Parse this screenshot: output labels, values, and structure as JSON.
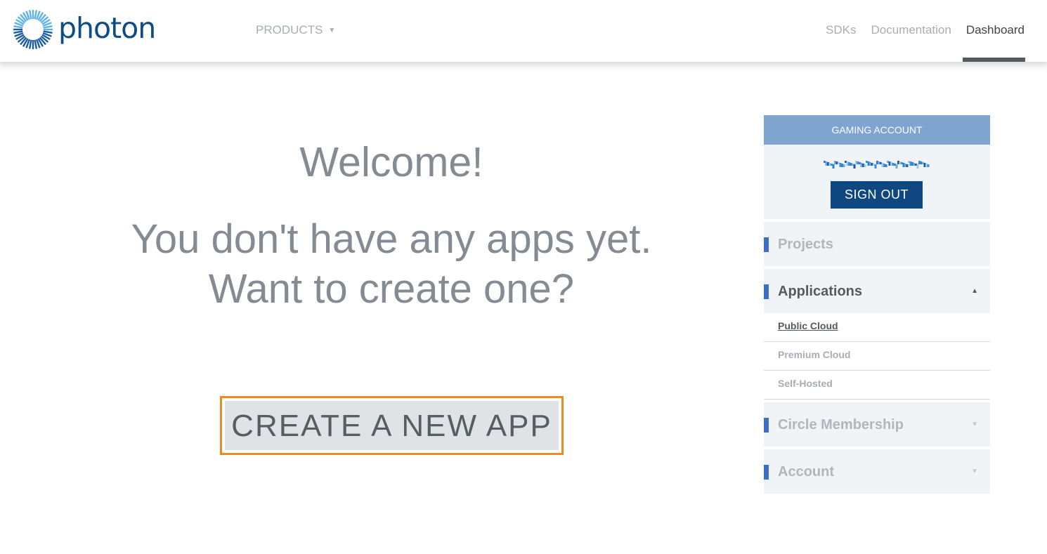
{
  "header": {
    "logo_text": "photon",
    "products_label": "PRODUCTS",
    "nav": [
      "SDKs",
      "Documentation",
      "Dashboard"
    ],
    "active_nav": "Dashboard"
  },
  "main": {
    "welcome": "Welcome!",
    "no_apps_line1": "You don't have any apps yet.",
    "no_apps_line2": "Want to create one?",
    "create_button": "CREATE A NEW APP"
  },
  "sidebar": {
    "account_header": "GAMING ACCOUNT",
    "sign_out": "SIGN OUT",
    "sections": [
      {
        "label": "Projects"
      },
      {
        "label": "Applications",
        "expanded": true,
        "items": [
          "Public Cloud",
          "Premium Cloud",
          "Self-Hosted"
        ],
        "active_item": "Public Cloud"
      },
      {
        "label": "Circle Membership"
      },
      {
        "label": "Account"
      }
    ]
  },
  "colors": {
    "brand_blue": "#0e4c86",
    "highlight_orange": "#f0891e",
    "account_header_bg": "#7fa4cf",
    "accent_bar": "#3c6fc5"
  }
}
